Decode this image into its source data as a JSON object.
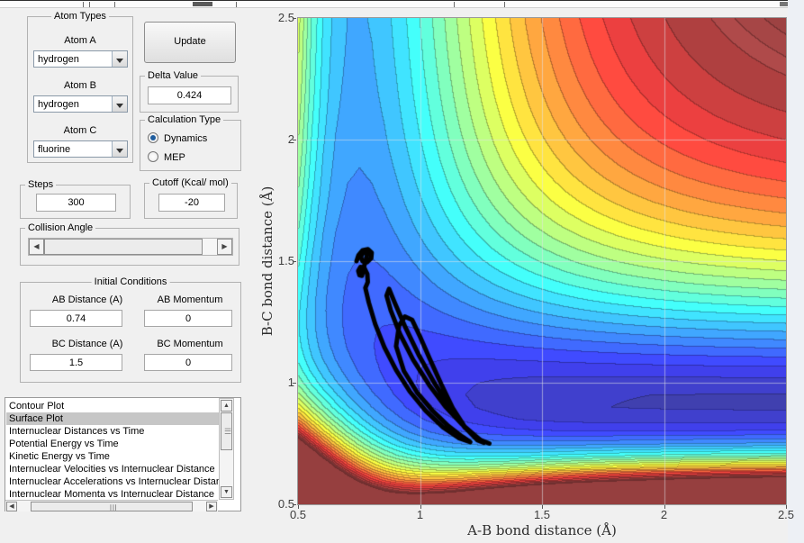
{
  "panels": {
    "atom_types": {
      "title": "Atom Types",
      "fields": [
        {
          "label": "Atom A",
          "value": "hydrogen"
        },
        {
          "label": "Atom B",
          "value": "hydrogen"
        },
        {
          "label": "Atom C",
          "value": "fluorine"
        }
      ]
    },
    "update_button": "Update",
    "delta_value": {
      "title": "Delta Value",
      "value": "0.424"
    },
    "calculation_type": {
      "title": "Calculation Type",
      "options": [
        {
          "label": "Dynamics",
          "selected": true
        },
        {
          "label": "MEP",
          "selected": false
        }
      ]
    },
    "steps": {
      "title": "Steps",
      "value": "300"
    },
    "cutoff": {
      "title": "Cutoff (Kcal/ mol)",
      "value": "-20"
    },
    "collision_angle": {
      "title": "Collision Angle"
    },
    "initial_conditions": {
      "title": "Initial Conditions",
      "fields": [
        {
          "label": "AB Distance (A)",
          "value": "0.74"
        },
        {
          "label": "AB Momentum",
          "value": "0"
        },
        {
          "label": "BC Distance (A)",
          "value": "1.5"
        },
        {
          "label": "BC Momentum",
          "value": "0"
        }
      ]
    },
    "plot_list": {
      "selected_index": 1,
      "items": [
        "Contour Plot",
        "Surface Plot",
        "Internuclear Distances vs Time",
        "Potential Energy vs Time",
        "Kinetic Energy vs Time",
        "Internuclear Velocities vs Internuclear Distance",
        "Internuclear Accelerations vs Internuclear Distance",
        "Internuclear Momenta vs Internuclear Distance"
      ]
    }
  },
  "chart_data": {
    "type": "heatmap",
    "subtype": "filled-contour-potential-energy-surface",
    "xlabel": "A-B bond distance (Å)",
    "ylabel": "B-C bond distance (Å)",
    "xlim": [
      0.5,
      2.5
    ],
    "ylim": [
      0.5,
      2.5
    ],
    "xticks": [
      0.5,
      1,
      1.5,
      2,
      2.5
    ],
    "yticks": [
      0.5,
      1,
      1.5,
      2,
      2.5
    ],
    "grid": true,
    "colormap": "jet",
    "cutoff_kcal_mol": -20,
    "vmin": -145,
    "level_step": 5,
    "clip_level_step": 2,
    "surface_model": {
      "type": "morse-sum-with-coupling",
      "AB": {
        "D": 109,
        "a": 1.95,
        "re": 0.741
      },
      "BC": {
        "D": 141,
        "a": 2.22,
        "re": 0.917
      },
      "coupling_scale": 141,
      "ac_repulsion": {
        "A": 300,
        "k": 3.5,
        "r0": 1.0
      }
    },
    "trajectory": {
      "color": "#000000",
      "width": 5,
      "points": [
        [
          0.74,
          1.5
        ],
        [
          0.748,
          1.525
        ],
        [
          0.765,
          1.545
        ],
        [
          0.787,
          1.549
        ],
        [
          0.802,
          1.535
        ],
        [
          0.8,
          1.512
        ],
        [
          0.783,
          1.495
        ],
        [
          0.764,
          1.5
        ],
        [
          0.757,
          1.519
        ],
        [
          0.768,
          1.535
        ],
        [
          0.786,
          1.537
        ],
        [
          0.778,
          1.505
        ],
        [
          0.768,
          1.468
        ],
        [
          0.762,
          1.44
        ],
        [
          0.752,
          1.442
        ],
        [
          0.747,
          1.46
        ],
        [
          0.756,
          1.476
        ],
        [
          0.772,
          1.472
        ],
        [
          0.784,
          1.447
        ],
        [
          0.786,
          1.414
        ],
        [
          0.776,
          1.39
        ],
        [
          0.79,
          1.33
        ],
        [
          0.816,
          1.242
        ],
        [
          0.854,
          1.146
        ],
        [
          0.902,
          1.052
        ],
        [
          0.958,
          0.964
        ],
        [
          1.024,
          0.884
        ],
        [
          1.094,
          0.817
        ],
        [
          1.158,
          0.773
        ],
        [
          1.206,
          0.756
        ],
        [
          1.172,
          0.779
        ],
        [
          1.116,
          0.822
        ],
        [
          1.052,
          0.884
        ],
        [
          0.988,
          0.96
        ],
        [
          0.934,
          1.048
        ],
        [
          0.902,
          1.15
        ],
        [
          0.914,
          1.235
        ],
        [
          0.938,
          1.272
        ],
        [
          0.968,
          1.258
        ],
        [
          1.0,
          1.19
        ],
        [
          1.04,
          1.098
        ],
        [
          1.086,
          0.996
        ],
        [
          1.134,
          0.896
        ],
        [
          1.188,
          0.812
        ],
        [
          1.236,
          0.763
        ],
        [
          1.262,
          0.753
        ],
        [
          1.228,
          0.781
        ],
        [
          1.17,
          0.831
        ],
        [
          1.104,
          0.902
        ],
        [
          1.038,
          0.99
        ],
        [
          0.972,
          1.094
        ],
        [
          0.918,
          1.2
        ],
        [
          0.88,
          1.298
        ],
        [
          0.863,
          1.358
        ],
        [
          0.873,
          1.386
        ],
        [
          0.896,
          1.33
        ],
        [
          0.94,
          1.228
        ],
        [
          0.994,
          1.116
        ],
        [
          1.056,
          1.004
        ],
        [
          1.122,
          0.898
        ],
        [
          1.184,
          0.815
        ],
        [
          1.234,
          0.77
        ],
        [
          1.284,
          0.75
        ]
      ]
    }
  }
}
